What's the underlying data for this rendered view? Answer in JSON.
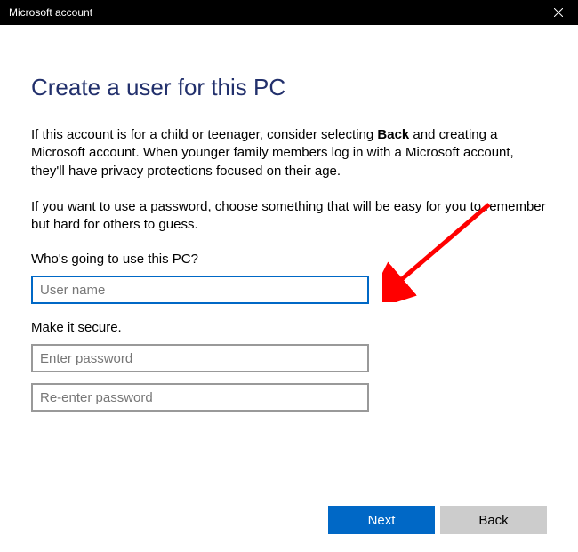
{
  "titlebar": {
    "title": "Microsoft account"
  },
  "heading": "Create a user for this PC",
  "desc1_pre": "If this account is for a child or teenager, consider selecting ",
  "desc1_bold": "Back",
  "desc1_post": " and creating a Microsoft account. When younger family members log in with a Microsoft account, they'll have privacy protections focused on their age.",
  "desc2": "If you want to use a password, choose something that will be easy for you to remember but hard for others to guess.",
  "section_user_label": "Who's going to use this PC?",
  "username_placeholder": "User name",
  "section_secure_label": "Make it secure.",
  "password_placeholder": "Enter password",
  "password2_placeholder": "Re-enter password",
  "buttons": {
    "next": "Next",
    "back": "Back"
  }
}
